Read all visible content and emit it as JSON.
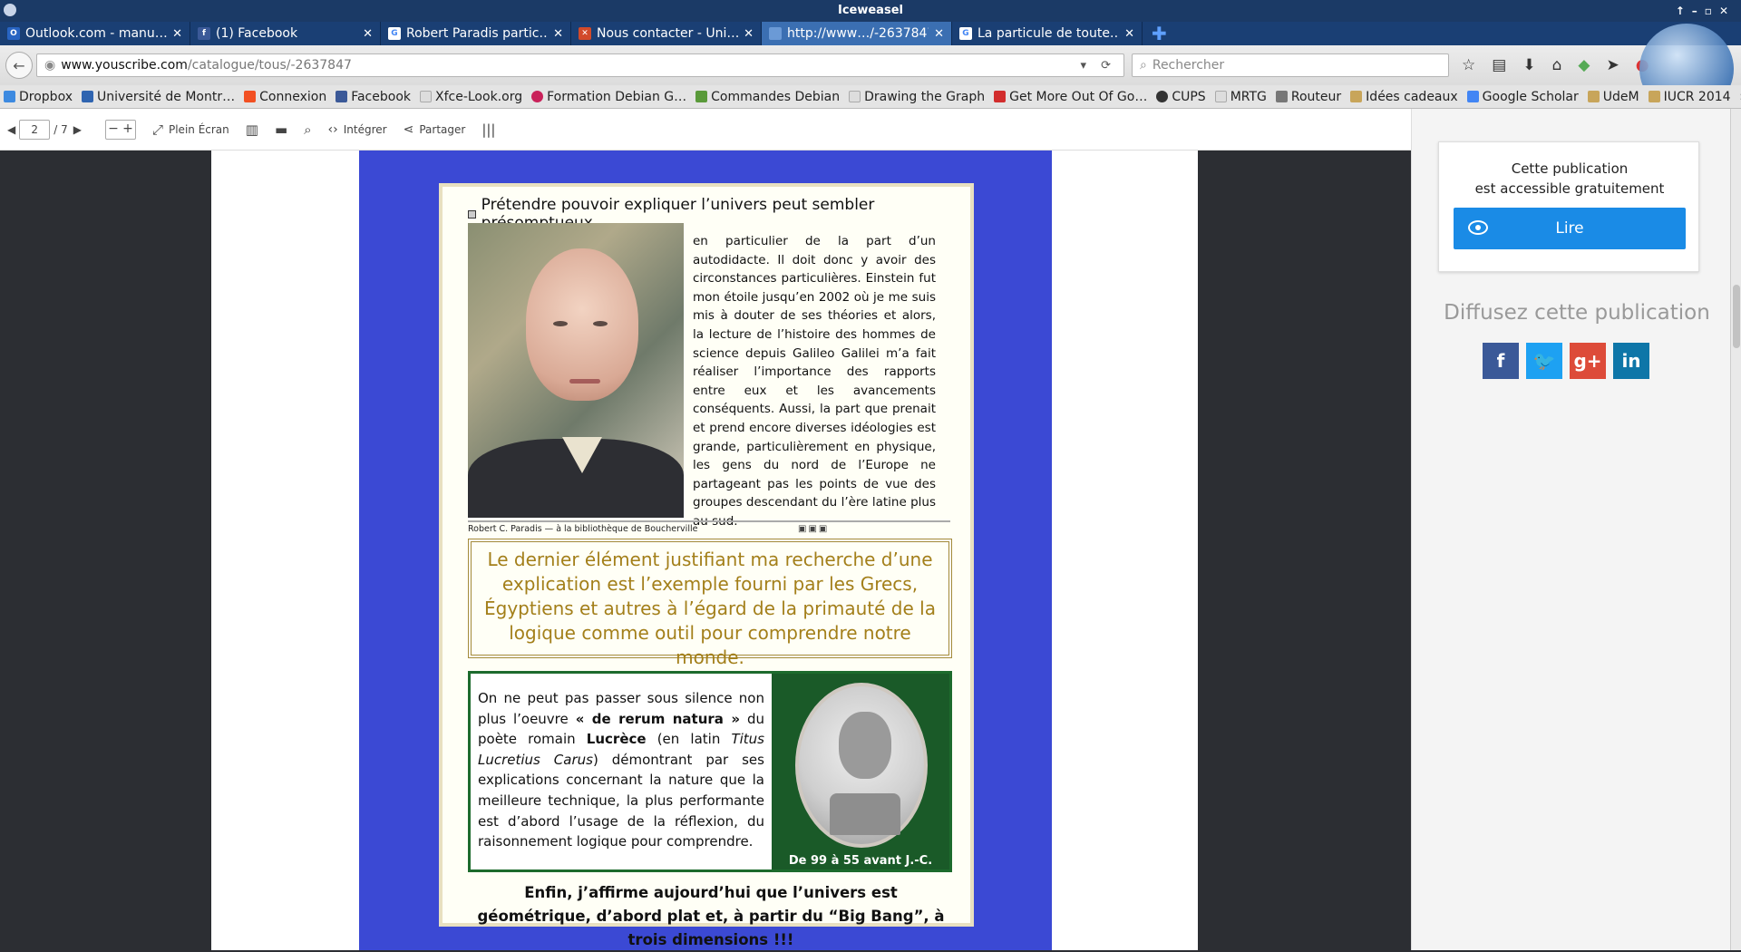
{
  "window": {
    "title": "Iceweasel"
  },
  "tabs": [
    {
      "label": "Outlook.com - manu…",
      "fav_color": "#2864c2",
      "fav_text": "O"
    },
    {
      "label": "(1) Facebook",
      "fav_color": "#3b5998",
      "fav_text": "f"
    },
    {
      "label": "Robert Paradis partic…",
      "fav_color": "#ffffff",
      "fav_text": "G"
    },
    {
      "label": "Nous contacter - Uni…",
      "fav_color": "#d24a2a",
      "fav_text": "✕"
    },
    {
      "label": "http://www…/-2637847",
      "fav_color": "#6b9ad6",
      "fav_text": ""
    },
    {
      "label": "La particule de toute…",
      "fav_color": "#ffffff",
      "fav_text": "G"
    }
  ],
  "url": {
    "host": "www.youscribe.com",
    "path": "/catalogue/tous/-2637847"
  },
  "search": {
    "placeholder": "Rechercher"
  },
  "bookmarks": [
    {
      "label": "Dropbox",
      "color": "#3d8ae0"
    },
    {
      "label": "Université de Montr…",
      "color": "#2f64b0"
    },
    {
      "label": "Connexion",
      "color": "#f25022"
    },
    {
      "label": "Facebook",
      "color": "#3b5998"
    },
    {
      "label": "Xfce-Look.org",
      "color": "#dddddd"
    },
    {
      "label": "Formation Debian G…",
      "color": "#c9225a"
    },
    {
      "label": "Commandes Debian",
      "color": "#5a9a3a"
    },
    {
      "label": "Drawing the Graph",
      "color": "#dddddd"
    },
    {
      "label": "Get More Out Of Go…",
      "color": "#d22d2d"
    },
    {
      "label": "CUPS",
      "color": "#333333"
    },
    {
      "label": "MRTG",
      "color": "#dddddd"
    },
    {
      "label": "Routeur",
      "color": "#777777"
    },
    {
      "label": "Idées cadeaux",
      "color": "#c8a55a"
    },
    {
      "label": "Google Scholar",
      "color": "#4285f4"
    },
    {
      "label": "UdeM",
      "color": "#c8a55a"
    },
    {
      "label": "IUCR 2014",
      "color": "#c8a55a"
    }
  ],
  "reader_toolbar": {
    "page_current": "2",
    "page_total": "/ 7",
    "fullscreen_label": "Plein Écran",
    "embed_label": "Intégrer",
    "share_label": "Partager"
  },
  "document": {
    "headline": "Prétendre pouvoir expliquer l’univers peut sembler présomptueux,",
    "intro": "en particulier de la part d’un autodidacte. Il doit donc y avoir des circonstances particulières. Einstein fut mon étoile jusqu’en 2002 où je me suis mis à douter de ses théories et alors, la lecture de l’histoire des hommes de science depuis Galileo Galilei m’a fait réaliser l’importance des rapports entre eux et les avancements conséquents. Aussi, la part que prenait et prend encore diverses idéologies est grande, particulièrement en physique, les gens du nord de l’Europe ne partageant pas les points de vue des groupes descendant du l’ère latine plus au sud.",
    "photo_caption": "Robert C. Paradis — à la bibliothèque de Boucherville",
    "quote": "Le dernier élément justifiant ma recherche d’une explication est l’exemple fourni par les Grecs, Égyptiens et autres à l’égard de la primauté de la logique comme outil pour comprendre notre monde.",
    "lucrece_text_1": "On ne peut pas passer sous silence non plus l’oeuvre ",
    "lucrece_title": "« de rerum natura »",
    "lucrece_text_2": " du poète romain ",
    "lucrece_name": "Lucrèce",
    "lucrece_text_3": " (en latin ",
    "lucrece_latin": "Titus Lucretius Carus",
    "lucrece_text_4": ") démontrant par ses explications concernant la nature que la meilleure technique, la plus performante est d’abord l’usage de la réflexion, du raisonnement logique pour comprendre.",
    "lucrece_dates": "De 99 à 55 avant J.-C.",
    "final": "Enfin, j’affirme aujourd’hui que l’univers est géométrique, d’abord plat et, à partir du “Big Bang”, à trois dimensions !!!"
  },
  "sidebar": {
    "access_line1": "Cette publication",
    "access_line2": "est accessible gratuitement",
    "read_button": "Lire",
    "share_heading": "Diffusez cette publication",
    "social": [
      {
        "name": "facebook",
        "glyph": "f",
        "color": "#3b5998"
      },
      {
        "name": "twitter",
        "glyph": "t",
        "color": "#1da1f2"
      },
      {
        "name": "google-plus",
        "glyph": "g+",
        "color": "#dd4b39"
      },
      {
        "name": "linkedin",
        "glyph": "in",
        "color": "#0e76a8"
      }
    ]
  }
}
